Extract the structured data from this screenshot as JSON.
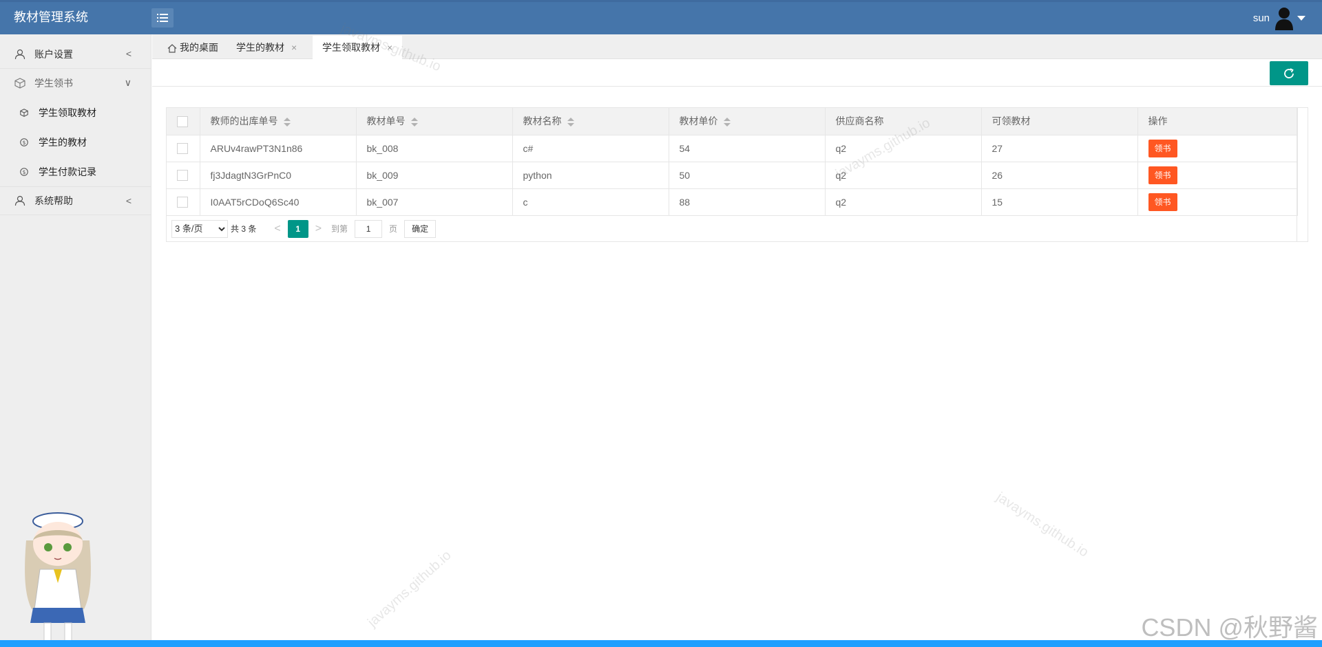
{
  "header": {
    "app_title": "教材管理系统",
    "username": "sun"
  },
  "sidebar": {
    "items": [
      {
        "label": "账户设置",
        "arrow": "<"
      },
      {
        "label": "学生领书",
        "arrow": "∨"
      },
      {
        "label": "系统帮助",
        "arrow": "<"
      }
    ],
    "subitems": [
      {
        "label": "学生领取教材"
      },
      {
        "label": "学生的教材"
      },
      {
        "label": "学生付款记录"
      }
    ]
  },
  "tabs": [
    {
      "label": "我的桌面"
    },
    {
      "label": "学生的教材",
      "close": "×"
    },
    {
      "label": "学生领取教材",
      "close": "×"
    }
  ],
  "table": {
    "headers": [
      "教师的出库单号",
      "教材单号",
      "教材名称",
      "教材单价",
      "供应商名称",
      "可领教材",
      "操作"
    ],
    "rows": [
      {
        "out_no": "ARUv4rawPT3N1n86",
        "book_no": "bk_008",
        "name": "c#",
        "price": "54",
        "supplier": "q2",
        "available": "27",
        "action": "领书"
      },
      {
        "out_no": "fj3JdagtN3GrPnC0",
        "book_no": "bk_009",
        "name": "python",
        "price": "50",
        "supplier": "q2",
        "available": "26",
        "action": "领书"
      },
      {
        "out_no": "I0AAT5rCDoQ6Sc40",
        "book_no": "bk_007",
        "name": "c",
        "price": "88",
        "supplier": "q2",
        "available": "15",
        "action": "领书"
      }
    ]
  },
  "pager": {
    "page_size": "3 条/页",
    "total": "共 3 条",
    "prev": "<",
    "current": "1",
    "next": ">",
    "goto_label": "到第",
    "goto_value": "1",
    "page_unit": "页",
    "confirm": "确定"
  },
  "watermarks": {
    "site": "javayms.github.io",
    "csdn": "CSDN @秋野酱"
  },
  "colors": {
    "header": "#4575aa",
    "primary": "#009688",
    "action": "#ff5722",
    "bottom_bar": "#1e9fff"
  }
}
